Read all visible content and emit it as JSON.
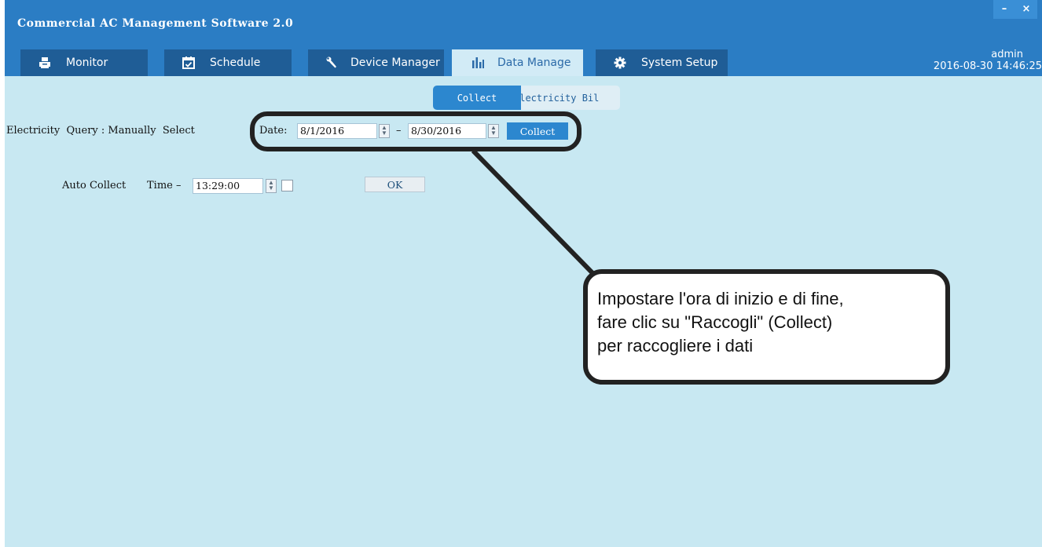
{
  "window": {
    "title": "Commercial AC Management Software 2.0",
    "minimize_label": "–",
    "close_label": "×"
  },
  "tabs": [
    {
      "label": "Monitor",
      "icon": "printer-icon"
    },
    {
      "label": "Schedule",
      "icon": "calendar-icon"
    },
    {
      "label": "Device Manager",
      "icon": "wrench-icon"
    },
    {
      "label": "Data Manage",
      "icon": "bar-chart-icon",
      "active": true
    },
    {
      "label": "System Setup",
      "icon": "gear-icon"
    }
  ],
  "user": {
    "name": "admin",
    "datetime": "2016-08-30 14:46:25"
  },
  "subtabs": [
    {
      "label": "Collect",
      "active": true
    },
    {
      "label": "Electricity Bil"
    }
  ],
  "query": {
    "label": "Electricity  Query : Manually  Select",
    "date_label": "Date:",
    "start_date": "8/1/2016",
    "separator": "–",
    "end_date": "8/30/2016",
    "collect_button": "Collect"
  },
  "auto_collect": {
    "label": "Auto Collect",
    "time_label": "Time –",
    "time_value": "13:29:00",
    "ok_button": "OK"
  },
  "callout": {
    "lines": [
      "Impostare l'ora di inizio e di fine,",
      "fare clic su \"Raccogli\" (Collect)",
      "per raccogliere i dati"
    ]
  },
  "colors": {
    "header": "#2b7dc4",
    "tab_inactive": "#1f5d96",
    "tab_active": "#d2ebf6",
    "background": "#c8e8f2",
    "accent_button": "#2c87cf"
  }
}
